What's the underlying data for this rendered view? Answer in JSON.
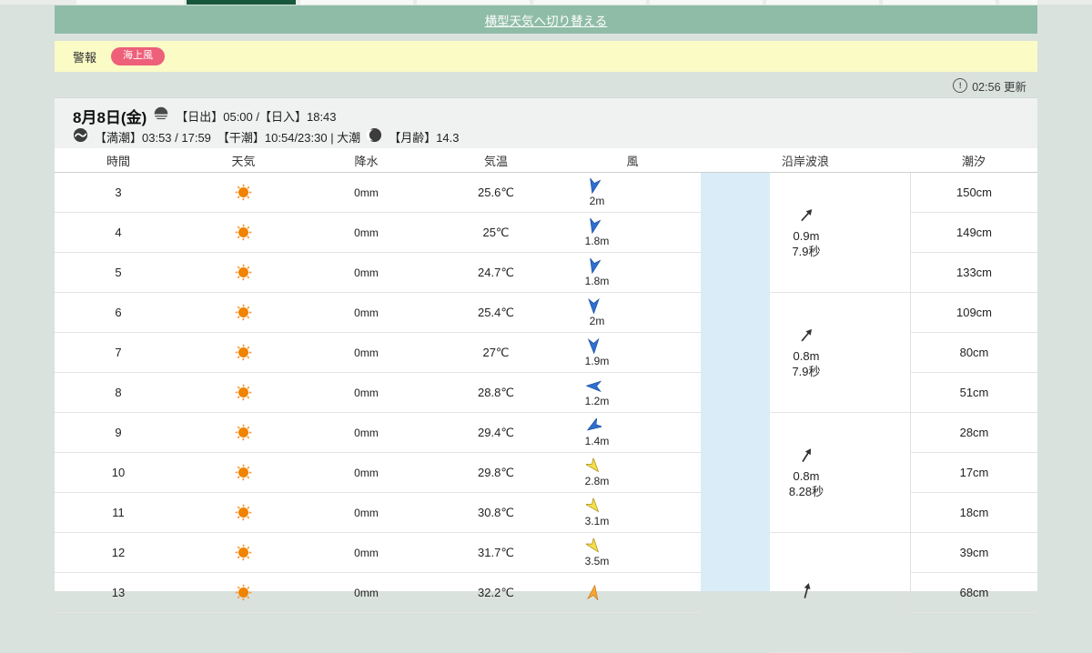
{
  "top": {
    "switch_link": "横型天気へ切り替える",
    "banner_color": "#8fbca7",
    "active_tab_color": "#17573c"
  },
  "alert": {
    "label": "警報",
    "badge": "海上風",
    "badge_color": "#ee5f79",
    "band_color": "#fafbc5"
  },
  "update": {
    "time_label": "02:56 更新"
  },
  "date_header": {
    "date": "8月8日(金)",
    "sun_times": "【日出】05:00 /【日入】18:43",
    "tide_high": "【満潮】03:53 / 17:59",
    "tide_low": "【干潮】10:54/23:30 | 大潮",
    "moon_age": "【月齢】14.3"
  },
  "table": {
    "headers": [
      "時間",
      "天気",
      "降水",
      "気温",
      "風",
      "沿岸波浪",
      "潮汐"
    ],
    "wind_colors": {
      "blue": {
        "fill": "#2f6fd2",
        "stroke": "#1b4f9e"
      },
      "yellow": {
        "fill": "#f3e04b",
        "stroke": "#b09020"
      },
      "orange": {
        "fill": "#f7a633",
        "stroke": "#c67f1f"
      }
    },
    "rows": [
      {
        "time": "3",
        "weather": "sunny",
        "precip": "0mm",
        "temp": "25.6℃",
        "wind": {
          "color": "blue",
          "deg": 192,
          "speed": "2m"
        },
        "tide": "150cm"
      },
      {
        "time": "4",
        "weather": "sunny",
        "precip": "0mm",
        "temp": "25℃",
        "wind": {
          "color": "blue",
          "deg": 192,
          "speed": "1.8m"
        },
        "tide": "149cm"
      },
      {
        "time": "5",
        "weather": "sunny",
        "precip": "0mm",
        "temp": "24.7℃",
        "wind": {
          "color": "blue",
          "deg": 192,
          "speed": "1.8m"
        },
        "tide": "133cm"
      },
      {
        "time": "6",
        "weather": "sunny",
        "precip": "0mm",
        "temp": "25.4℃",
        "wind": {
          "color": "blue",
          "deg": 180,
          "speed": "2m"
        },
        "tide": "109cm"
      },
      {
        "time": "7",
        "weather": "sunny",
        "precip": "0mm",
        "temp": "27℃",
        "wind": {
          "color": "blue",
          "deg": 178,
          "speed": "1.9m"
        },
        "tide": "80cm"
      },
      {
        "time": "8",
        "weather": "sunny",
        "precip": "0mm",
        "temp": "28.8℃",
        "wind": {
          "color": "blue",
          "deg": 272,
          "speed": "1.2m"
        },
        "tide": "51cm"
      },
      {
        "time": "9",
        "weather": "sunny",
        "precip": "0mm",
        "temp": "29.4℃",
        "wind": {
          "color": "blue",
          "deg": 237,
          "speed": "1.4m"
        },
        "tide": "28cm"
      },
      {
        "time": "10",
        "weather": "sunny",
        "precip": "0mm",
        "temp": "29.8℃",
        "wind": {
          "color": "yellow",
          "deg": 140,
          "speed": "2.8m"
        },
        "tide": "17cm"
      },
      {
        "time": "11",
        "weather": "sunny",
        "precip": "0mm",
        "temp": "30.8℃",
        "wind": {
          "color": "yellow",
          "deg": 140,
          "speed": "3.1m"
        },
        "tide": "18cm"
      },
      {
        "time": "12",
        "weather": "sunny",
        "precip": "0mm",
        "temp": "31.7℃",
        "wind": {
          "color": "yellow",
          "deg": 142,
          "speed": "3.5m"
        },
        "tide": "39cm"
      },
      {
        "time": "13",
        "weather": "sunny",
        "precip": "0mm",
        "temp": "32.2℃",
        "wind": {
          "color": "orange",
          "deg": 8,
          "speed": ""
        },
        "tide": "68cm"
      }
    ],
    "wave_groups": [
      {
        "deg": 42,
        "height": "0.9m",
        "period": "7.9秒"
      },
      {
        "deg": 40,
        "height": "0.8m",
        "period": "7.9秒"
      },
      {
        "deg": 32,
        "height": "0.8m",
        "period": "8.28秒"
      },
      {
        "deg": 15,
        "height": "",
        "period": ""
      }
    ]
  }
}
